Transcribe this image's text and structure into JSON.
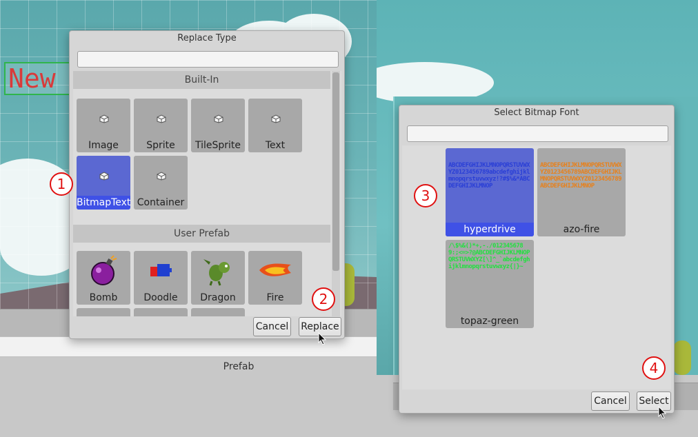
{
  "background": {
    "left_scene_text": "New",
    "prefab_panel_label": "Prefab"
  },
  "replace_dialog": {
    "title": "Replace Type",
    "filter_value": "",
    "sections": {
      "built_in": "Built-In",
      "user_prefab": "User Prefab"
    },
    "built_in_items": [
      {
        "label": "Image",
        "icon": "cube-icon",
        "selected": false
      },
      {
        "label": "Sprite",
        "icon": "cube-icon",
        "selected": false
      },
      {
        "label": "TileSprite",
        "icon": "cube-icon",
        "selected": false
      },
      {
        "label": "Text",
        "icon": "cube-icon",
        "selected": false
      },
      {
        "label": "BitmapText",
        "icon": "cube-icon",
        "selected": true
      },
      {
        "label": "Container",
        "icon": "cube-icon",
        "selected": false
      }
    ],
    "prefab_items": [
      {
        "label": "Bomb",
        "icon": "bomb-icon"
      },
      {
        "label": "Doodle",
        "icon": "doodle-icon"
      },
      {
        "label": "Dragon",
        "icon": "dragon-icon"
      },
      {
        "label": "Fire",
        "icon": "fire-icon"
      }
    ],
    "buttons": {
      "cancel": "Cancel",
      "replace": "Replace"
    }
  },
  "font_dialog": {
    "title": "Select Bitmap Font",
    "filter_value": "",
    "fonts": [
      {
        "label": "hyperdrive",
        "selected": true,
        "preview_color": "#2a3fd6"
      },
      {
        "label": "azo-fire",
        "selected": false,
        "preview_color": "#e8801a"
      },
      {
        "label": "topaz-green",
        "selected": false,
        "preview_color": "#22e040"
      }
    ],
    "buttons": {
      "cancel": "Cancel",
      "select": "Select"
    }
  },
  "step_markers": [
    "1",
    "2",
    "3",
    "4"
  ],
  "colors": {
    "selection": "#3f51e6",
    "marker": "#e01010",
    "sky": "#5db3b6"
  }
}
